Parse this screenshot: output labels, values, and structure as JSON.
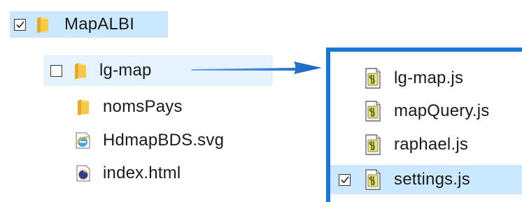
{
  "left_tree": {
    "root": {
      "name": "MapALBI",
      "checked": true,
      "icon": "folder-icon"
    },
    "children": [
      {
        "name": "lg-map",
        "checked": false,
        "icon": "folder-icon",
        "state": "hover"
      },
      {
        "name": "nomsPays",
        "icon": "folder-icon"
      },
      {
        "name": "HdmapBDS.svg",
        "icon": "ie-svg-file-icon"
      },
      {
        "name": "index.html",
        "icon": "firefox-html-file-icon"
      }
    ]
  },
  "right_panel": {
    "files": [
      {
        "name": "lg-map.js",
        "icon": "js-script-file-icon"
      },
      {
        "name": "mapQuery.js",
        "icon": "js-script-file-icon"
      },
      {
        "name": "raphael.js",
        "icon": "js-script-file-icon"
      },
      {
        "name": "settings.js",
        "icon": "js-script-file-icon",
        "checked": true
      }
    ]
  },
  "colors": {
    "selection": "#cce8ff",
    "hover": "#e5f3ff",
    "accent_blue": "#1976d2",
    "folder_yellow": "#f6c343"
  }
}
